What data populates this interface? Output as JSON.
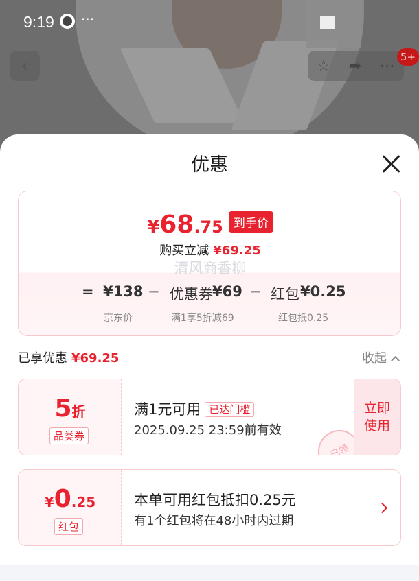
{
  "status": {
    "time": "9:19",
    "more": "···"
  },
  "nav": {
    "back_icon": "‹",
    "badge": "5+"
  },
  "sheet": {
    "title": "优惠",
    "summary": {
      "currency": "¥",
      "final_int": "68",
      "final_dec": ".75",
      "final_tag": "到手价",
      "reduce_label": "购买立减",
      "reduce_amount": "¥69.25",
      "watermark": "清风商香柳",
      "eq": "=",
      "base_price": "¥138",
      "minus1": "−",
      "coupon_label": "优惠券",
      "coupon_amount": "¥69",
      "minus2": "−",
      "redpacket_label": "红包",
      "redpacket_amount": "¥0.25",
      "base_sub": "京东价",
      "coupon_sub": "满1享5折减69",
      "redpacket_sub": "红包抵0.25"
    },
    "enjoyed": {
      "label": "已享优惠",
      "amount": "¥69.25",
      "collapse": "收起"
    },
    "coupon": {
      "value": "5",
      "unit": "折",
      "type": "品类券",
      "condition": "满1元可用",
      "reach_tag": "已达门槛",
      "expiry": "2025.09.25 23:59前有效",
      "use_line1": "立即",
      "use_line2": "使用",
      "stamp": "已领"
    },
    "redpacket": {
      "currency": "¥",
      "value_int": "0",
      "value_dec": ".25",
      "type": "红包",
      "line1": "本单可用红包抵扣0.25元",
      "line2": "有1个红包将在48小时内过期"
    }
  },
  "colors": {
    "accent": "#e8222f",
    "border": "#f7c9cd",
    "tint": "#fff4f6"
  }
}
